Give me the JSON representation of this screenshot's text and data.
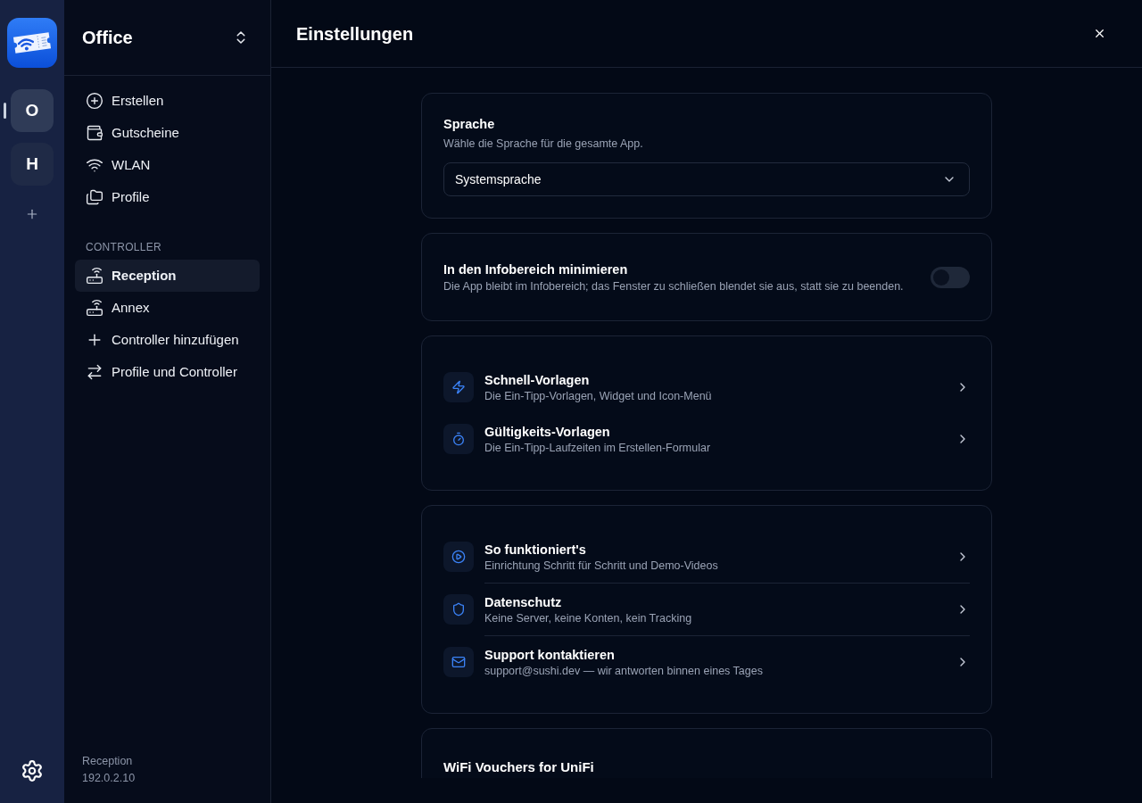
{
  "rail": {
    "workspaces": [
      {
        "label": "O",
        "selected": true
      },
      {
        "label": "H",
        "selected": false
      }
    ]
  },
  "sidebar": {
    "title": "Office",
    "nav": [
      {
        "label": "Erstellen",
        "selected": false
      },
      {
        "label": "Gutscheine",
        "selected": false
      },
      {
        "label": "WLAN",
        "selected": false
      },
      {
        "label": "Profile",
        "selected": false
      }
    ],
    "controller_section": {
      "heading": "CONTROLLER",
      "controllers": [
        {
          "label": "Reception",
          "selected": true
        },
        {
          "label": "Annex",
          "selected": false
        }
      ],
      "actions": [
        {
          "label": "Controller hinzufügen"
        },
        {
          "label": "Profile und Controller"
        }
      ]
    },
    "footer": {
      "name": "Reception",
      "address": "192.0.2.10"
    }
  },
  "settings": {
    "title": "Einstellungen",
    "language": {
      "title": "Sprache",
      "description": "Wähle die Sprache für die gesamte App.",
      "value": "Systemsprache"
    },
    "tray": {
      "title": "In den Infobereich minimieren",
      "description": "Die App bleibt im Infobereich; das Fenster zu schließen blendet sie aus, statt sie zu beenden.",
      "on": false
    },
    "templates": [
      {
        "title": "Schnell-Vorlagen",
        "description": "Die Ein-Tipp-Vorlagen, Widget und Icon-Menü"
      },
      {
        "title": "Gültigkeits-Vorlagen",
        "description": "Die Ein-Tipp-Laufzeiten im Erstellen-Formular"
      }
    ],
    "info": [
      {
        "title": "So funktioniert's",
        "description": "Einrichtung Schritt für Schritt und Demo-Videos"
      },
      {
        "title": "Datenschutz",
        "description": "Keine Server, keine Konten, kein Tracking"
      },
      {
        "title": "Support kontaktieren",
        "description": "support@sushi.dev — wir antworten binnen eines Tages"
      }
    ],
    "about": {
      "title": "WiFi Vouchers for UniFi"
    }
  }
}
